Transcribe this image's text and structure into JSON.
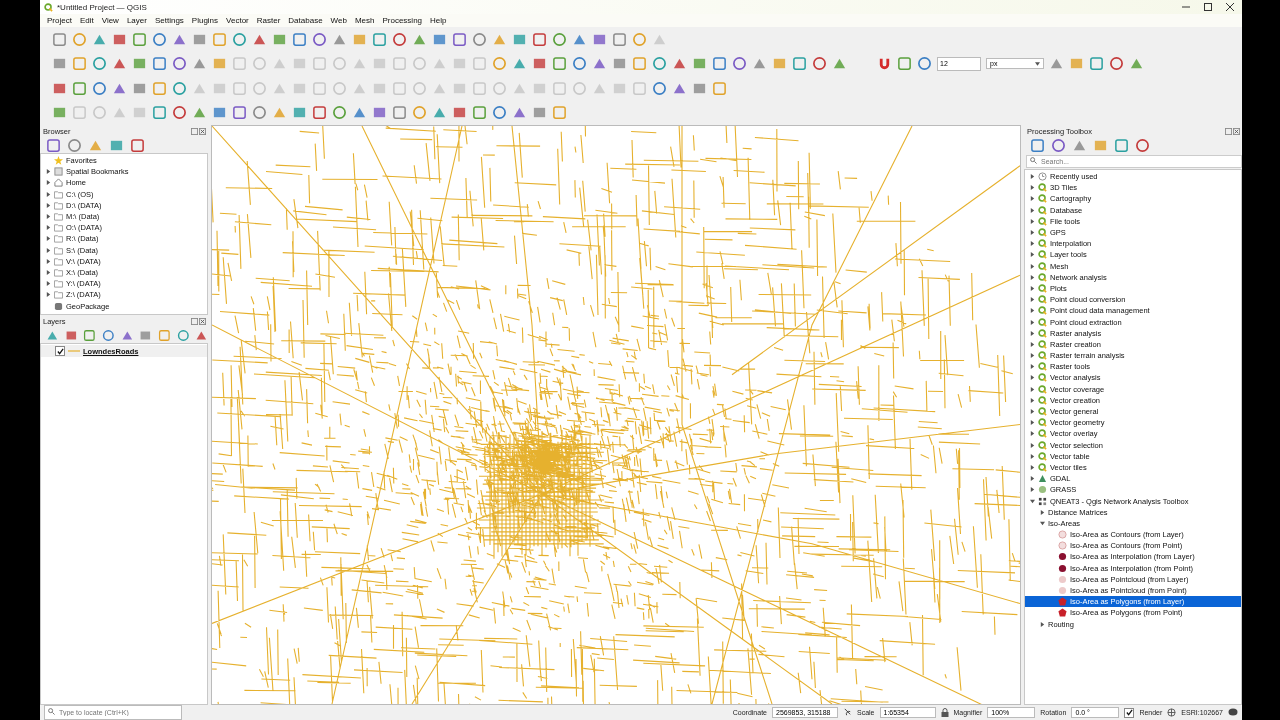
{
  "window": {
    "title": "*Untitled Project — QGIS"
  },
  "menu": [
    "Project",
    "Edit",
    "View",
    "Layer",
    "Settings",
    "Plugins",
    "Vector",
    "Raster",
    "Database",
    "Web",
    "Mesh",
    "Processing",
    "Help"
  ],
  "snapping": {
    "tolerance": "12",
    "unit": "px"
  },
  "browser": {
    "title": "Browser",
    "items": [
      {
        "label": "Favorites",
        "kind": "favorites"
      },
      {
        "label": "Spatial Bookmarks",
        "kind": "bookmarks",
        "expanded": false
      },
      {
        "label": "Home",
        "kind": "home",
        "expanded": false
      },
      {
        "label": "C:\\ (OS)",
        "kind": "drive",
        "expanded": false
      },
      {
        "label": "D:\\ (DATA)",
        "kind": "drive",
        "expanded": false
      },
      {
        "label": "M:\\ (Data)",
        "kind": "drive",
        "expanded": false
      },
      {
        "label": "O:\\ (DATA)",
        "kind": "drive",
        "expanded": false
      },
      {
        "label": "R:\\ (Data)",
        "kind": "drive",
        "expanded": false
      },
      {
        "label": "S:\\ (Data)",
        "kind": "drive",
        "expanded": false
      },
      {
        "label": "V:\\ (DATA)",
        "kind": "drive",
        "expanded": false
      },
      {
        "label": "X:\\ (Data)",
        "kind": "drive",
        "expanded": false
      },
      {
        "label": "Y:\\ (DATA)",
        "kind": "drive",
        "expanded": false
      },
      {
        "label": "Z:\\ (DATA)",
        "kind": "drive",
        "expanded": false
      },
      {
        "label": "GeoPackage",
        "kind": "geopackage"
      }
    ]
  },
  "layers": {
    "title": "Layers",
    "items": [
      {
        "label": "LowndesRoads",
        "checked": true
      }
    ]
  },
  "toolbox": {
    "title": "Processing Toolbox",
    "search": {
      "placeholder": "Search..."
    },
    "items": [
      {
        "label": "Recently used",
        "kind": "recent",
        "expanded": false,
        "selected": false
      },
      {
        "label": "3D Tiles",
        "kind": "qgis",
        "expanded": false,
        "selected": false
      },
      {
        "label": "Cartography",
        "kind": "qgis",
        "expanded": false,
        "selected": false
      },
      {
        "label": "Database",
        "kind": "qgis",
        "expanded": false,
        "selected": false
      },
      {
        "label": "File tools",
        "kind": "qgis",
        "expanded": false,
        "selected": false
      },
      {
        "label": "GPS",
        "kind": "qgis",
        "expanded": false,
        "selected": false
      },
      {
        "label": "Interpolation",
        "kind": "qgis",
        "expanded": false,
        "selected": false
      },
      {
        "label": "Layer tools",
        "kind": "qgis",
        "expanded": false,
        "selected": false
      },
      {
        "label": "Mesh",
        "kind": "qgis",
        "expanded": false,
        "selected": false
      },
      {
        "label": "Network analysis",
        "kind": "qgis",
        "expanded": false,
        "selected": false
      },
      {
        "label": "Plots",
        "kind": "qgis",
        "expanded": false,
        "selected": false
      },
      {
        "label": "Point cloud conversion",
        "kind": "qgis",
        "expanded": false,
        "selected": false
      },
      {
        "label": "Point cloud data management",
        "kind": "qgis",
        "expanded": false,
        "selected": false
      },
      {
        "label": "Point cloud extraction",
        "kind": "qgis",
        "expanded": false,
        "selected": false
      },
      {
        "label": "Raster analysis",
        "kind": "qgis",
        "expanded": false,
        "selected": false
      },
      {
        "label": "Raster creation",
        "kind": "qgis",
        "expanded": false,
        "selected": false
      },
      {
        "label": "Raster terrain analysis",
        "kind": "qgis",
        "expanded": false,
        "selected": false
      },
      {
        "label": "Raster tools",
        "kind": "qgis",
        "expanded": false,
        "selected": false
      },
      {
        "label": "Vector analysis",
        "kind": "qgis",
        "expanded": false,
        "selected": false
      },
      {
        "label": "Vector coverage",
        "kind": "qgis",
        "expanded": false,
        "selected": false
      },
      {
        "label": "Vector creation",
        "kind": "qgis",
        "expanded": false,
        "selected": false
      },
      {
        "label": "Vector general",
        "kind": "qgis",
        "expanded": false,
        "selected": false
      },
      {
        "label": "Vector geometry",
        "kind": "qgis",
        "expanded": false,
        "selected": false
      },
      {
        "label": "Vector overlay",
        "kind": "qgis",
        "expanded": false,
        "selected": false
      },
      {
        "label": "Vector selection",
        "kind": "qgis",
        "expanded": false,
        "selected": false
      },
      {
        "label": "Vector table",
        "kind": "qgis",
        "expanded": false,
        "selected": false
      },
      {
        "label": "Vector tiles",
        "kind": "qgis",
        "expanded": false,
        "selected": false
      },
      {
        "label": "GDAL",
        "kind": "gdal",
        "expanded": false,
        "selected": false
      },
      {
        "label": "GRASS",
        "kind": "grass",
        "expanded": false,
        "selected": false
      },
      {
        "label": "QNEAT3 - Qgis Network Analysis Toolbox",
        "kind": "plugin",
        "expanded": true,
        "selected": false,
        "children": [
          {
            "label": "Distance Matrices",
            "expanded": false,
            "selected": false
          },
          {
            "label": "Iso-Areas",
            "expanded": true,
            "selected": false,
            "children": [
              {
                "label": "Iso-Area as Contours (from Layer)",
                "kind": "contour",
                "selected": false
              },
              {
                "label": "Iso-Area as Contours (from Point)",
                "kind": "contour",
                "selected": false
              },
              {
                "label": "Iso-Area as Interpolation (from Layer)",
                "kind": "interpolation",
                "selected": false
              },
              {
                "label": "Iso-Area as Interpolation (from Point)",
                "kind": "interpolation",
                "selected": false
              },
              {
                "label": "Iso-Area as Pointcloud (from Layer)",
                "kind": "pointcloud",
                "selected": false
              },
              {
                "label": "Iso-Area as Pointcloud (from Point)",
                "kind": "pointcloud",
                "selected": false
              },
              {
                "label": "Iso-Area as Polygons (from Layer)",
                "kind": "polygon",
                "selected": true
              },
              {
                "label": "Iso-Area as Polygons (from Point)",
                "kind": "polygon",
                "selected": false
              }
            ]
          },
          {
            "label": "Routing",
            "expanded": false,
            "selected": false
          }
        ]
      }
    ]
  },
  "status_bar": {
    "locate": {
      "placeholder": "Type to locate (Ctrl+K)"
    },
    "coordinate_label": "Coordinate",
    "coordinate": "2569853, 315188",
    "scale_label": "Scale",
    "scale": "1:65354",
    "magnifier_label": "Magnifier",
    "magnifier": "100%",
    "rotation_label": "Rotation",
    "rotation": "0.0 °",
    "render": {
      "label": "Render",
      "checked": true
    },
    "crs": "ESRI:102667"
  }
}
